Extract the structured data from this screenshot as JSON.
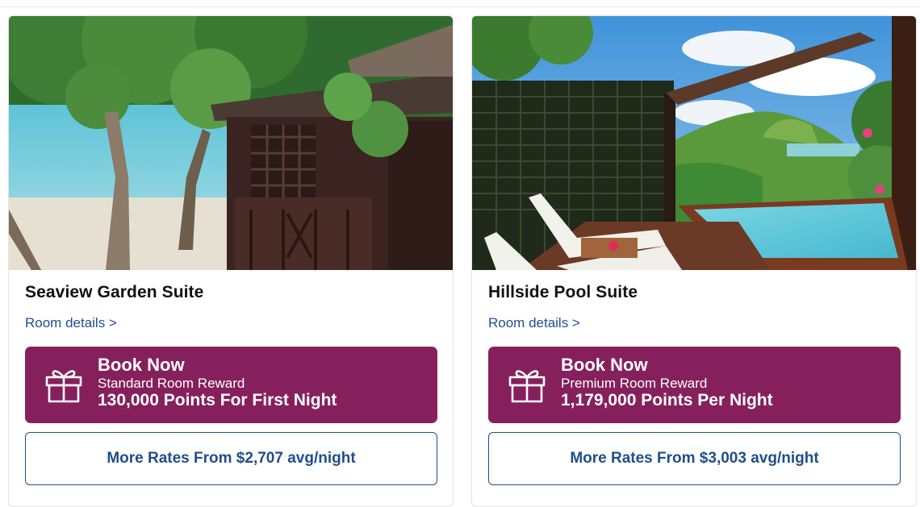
{
  "rooms": [
    {
      "title": "Seaview Garden Suite",
      "details_link": "Room details >",
      "book": {
        "heading": "Book Now",
        "reward": "Standard Room Reward",
        "points": "130,000 Points For First Night"
      },
      "more_rates": "More Rates From $2,707 avg/night"
    },
    {
      "title": "Hillside Pool Suite",
      "details_link": "Room details >",
      "book": {
        "heading": "Book Now",
        "reward": "Premium Room Reward",
        "points": "1,179,000 Points Per Night"
      },
      "more_rates": "More Rates From $3,003 avg/night"
    }
  ],
  "colors": {
    "book_bg": "#86205c",
    "link": "#1f4e8c",
    "title": "#111111"
  },
  "icons": {
    "book": "gift-icon"
  }
}
